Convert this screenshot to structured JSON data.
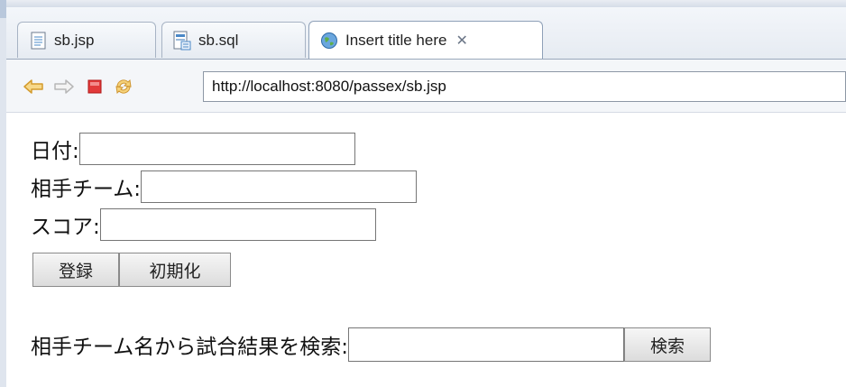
{
  "tabs": [
    {
      "label": "sb.jsp",
      "icon": "document-icon",
      "active": false
    },
    {
      "label": "sb.sql",
      "icon": "database-file-icon",
      "active": false
    },
    {
      "label": "Insert title here",
      "icon": "globe-icon",
      "active": true,
      "close": "✕"
    }
  ],
  "browser": {
    "url": "http://localhost:8080/passex/sb.jsp"
  },
  "form": {
    "date_label": "日付:",
    "opponent_label": "相手チーム:",
    "score_label": "スコア:",
    "register_button": "登録",
    "reset_button": "初期化"
  },
  "search": {
    "label": "相手チーム名から試合結果を検索:",
    "button": "検索"
  },
  "colors": {
    "back_arrow": "#e0a83c",
    "stop": "#e02020",
    "refresh": "#e0a83c"
  }
}
